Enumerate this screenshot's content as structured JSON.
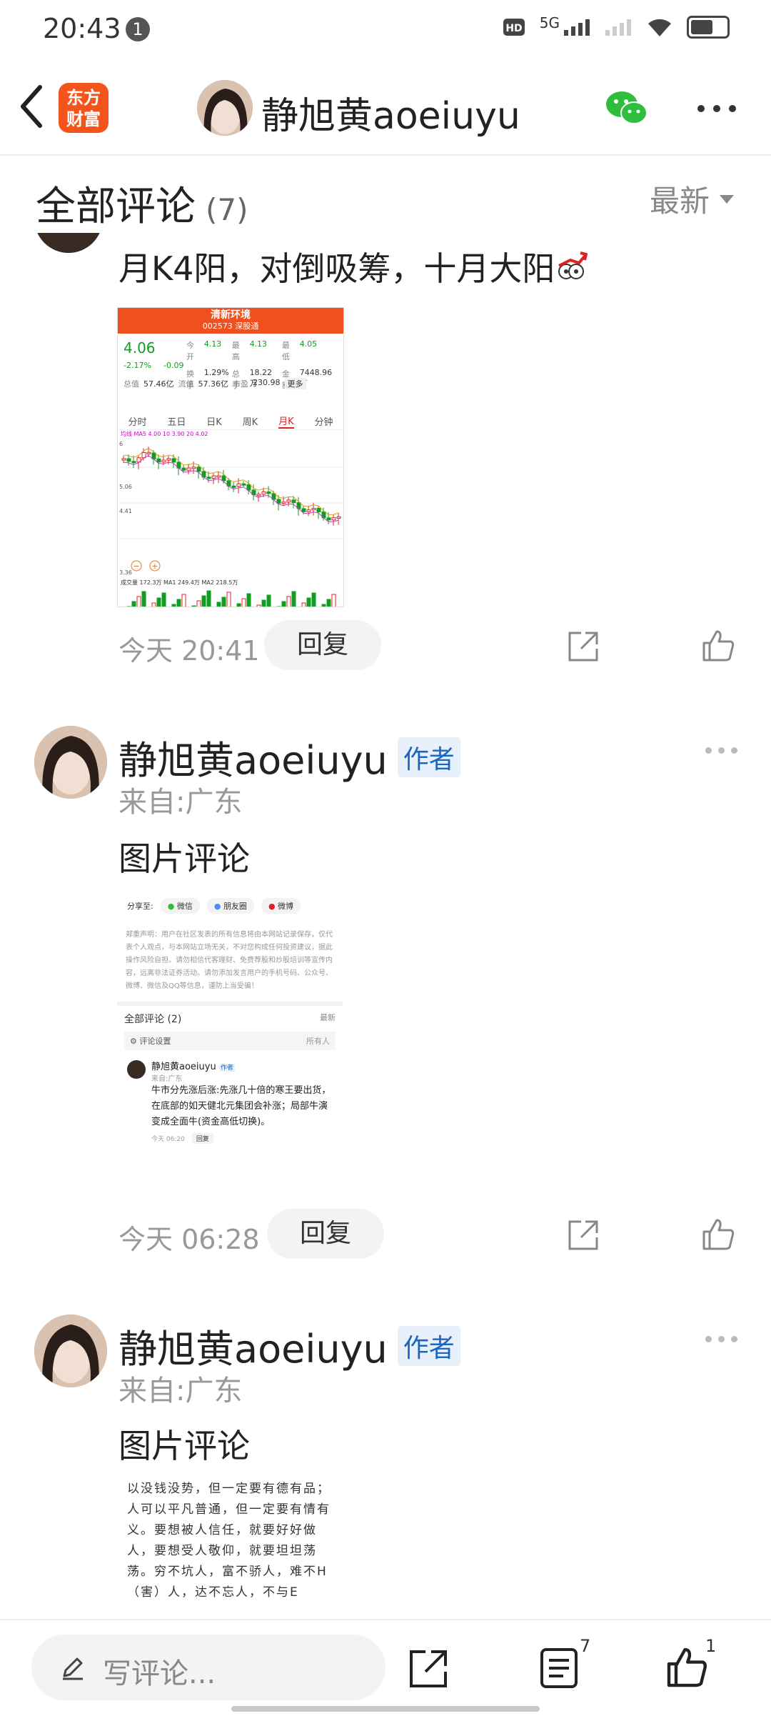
{
  "status": {
    "time": "20:43",
    "notif_count": "1",
    "network": "5G",
    "battery_level": 0.55
  },
  "header": {
    "app_logo": [
      "东方",
      "财富"
    ],
    "name": "静旭黄aoeiuyu"
  },
  "comments_header": {
    "title": "全部评论",
    "count": "(7)",
    "sort": "最新"
  },
  "comments": [
    {
      "text": "月K4阳，对倒吸筹，十月大阳",
      "time": "今天 20:41",
      "reply": "回复",
      "image": {
        "stock_name": "清新环境",
        "stock_code": "002573 深股通",
        "price": "4.06",
        "change_pct": "-2.17%",
        "change": "-0.09",
        "open_label": "今开",
        "open": "4.13",
        "high_label": "最高",
        "high": "4.13",
        "low_label": "最低",
        "low": "4.05",
        "turnover_label": "换手",
        "turnover": "1.29%",
        "volume_label": "总手",
        "volume": "18.22万",
        "amount_label": "金额",
        "amount": "7448.96万",
        "total_mv_label": "总值",
        "total_mv": "57.46亿",
        "float_mv_label": "流值",
        "float_mv": "57.36亿",
        "pe_label": "市盈",
        "pe": "230.98",
        "more_label": "更多",
        "tabs": [
          "分时",
          "五日",
          "日K",
          "周K",
          "月K",
          "分钟"
        ],
        "active_tab": "月K",
        "ma_line": "均线 MA5 4.00  10 3.90  20 4.02",
        "price_labels": [
          "6",
          "5.06",
          "4.41",
          "3.36"
        ],
        "volume_line": "成交量 172.3万  MA1 249.4万  MA2 218.5万"
      }
    },
    {
      "author": "静旭黄aoeiuyu",
      "badge": "作者",
      "from": "来自:广东",
      "text": "图片评论",
      "time": "今天 06:28",
      "reply": "回复",
      "image": {
        "share_label": "分享至:",
        "share_targets": [
          "微信",
          "朋友圈",
          "微博"
        ],
        "disclaimer": "郑重声明：用户在社区发表的所有信息将由本网站记录保存，仅代表个人观点，与本网站立场无关，不对您构成任何投资建议，据此操作风险自担。请勿相信代客理财、免费荐股和炒股培训等宣传内容，远离非法证券活动。请勿添加发言用户的手机号码、公众号、微博、微信及QQ等信息，谨防上当受骗！",
        "comments_title": "全部评论 (2)",
        "sort": "最新",
        "settings": "评论设置",
        "settings_value": "所有人",
        "inner_author": "静旭黄aoeiuyu",
        "inner_badge": "作者",
        "inner_from": "来自:广东",
        "inner_text": "牛市分先涨后涨:先涨几十倍的寒王要出货，在底部的如天健北元集团会补涨；局部牛演变成全面牛(资金高低切换)。",
        "inner_time": "今天 06:20",
        "inner_reply": "回复"
      }
    },
    {
      "author": "静旭黄aoeiuyu",
      "badge": "作者",
      "from": "来自:广东",
      "text": "图片评论",
      "image_text": [
        "以没钱没势，但一定要有德有品；",
        "人可以平凡普通，但一定要有情有",
        "义。要想被人信任，就要好好做",
        "人，要想受人敬仰，就要坦坦荡",
        "荡。穷不坑人，富不骄人，难不H",
        "（害）人，达不忘人，不与E"
      ]
    }
  ],
  "bottom_bar": {
    "placeholder": "写评论...",
    "comment_count": "7",
    "like_count": "1"
  },
  "colors": {
    "brand": "#f2541b",
    "price_up": "#e02020",
    "price_down": "#109d21",
    "badge": "#1b66c4"
  }
}
